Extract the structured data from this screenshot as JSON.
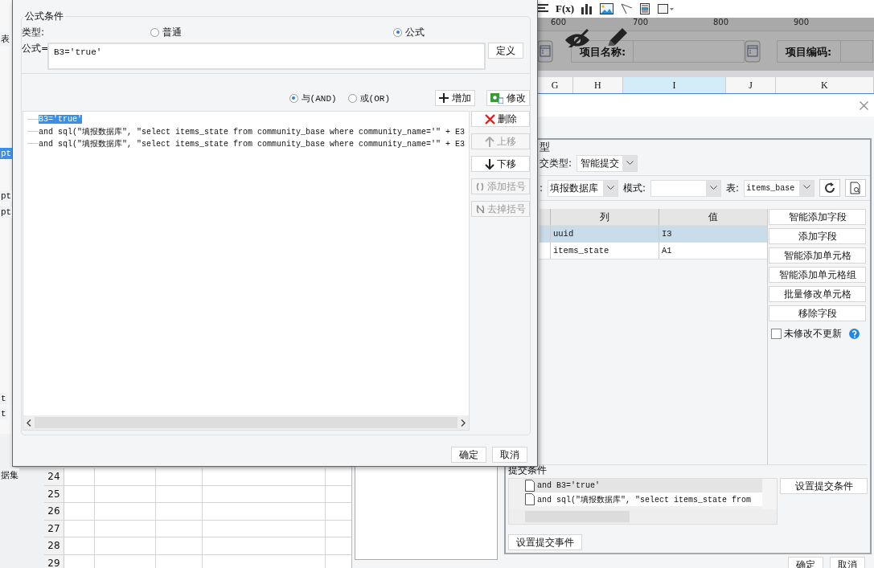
{
  "background": {
    "side_labels": [
      {
        "text": "表",
        "selected": false
      },
      {
        "text": "pt",
        "selected": true
      },
      {
        "text": "pt",
        "selected": false
      },
      {
        "text": "pt",
        "selected": false
      },
      {
        "text": "t",
        "selected": false
      },
      {
        "text": "t",
        "selected": false
      },
      {
        "text": "据集",
        "selected": false
      }
    ],
    "formula_tool": "F(x)",
    "ruler": [
      "600",
      "700",
      "800",
      "900"
    ],
    "parameters": [
      {
        "label": "项目名称:"
      },
      {
        "label": "项目编码:"
      }
    ],
    "columns": [
      {
        "label": "G",
        "selected": false
      },
      {
        "label": "H",
        "selected": false
      },
      {
        "label": "I",
        "selected": true
      },
      {
        "label": "J",
        "selected": false
      },
      {
        "label": "K",
        "selected": false
      }
    ],
    "row_numbers": [
      "24",
      "25",
      "26",
      "27",
      "28",
      "29"
    ]
  },
  "submit_dialog": {
    "section_title": "型",
    "submit_type": {
      "label": "交类型:",
      "value": "智能提交"
    },
    "source": {
      "label": ":",
      "database": "填报数据库",
      "mode_label": "模式:",
      "table_label": "表:",
      "table": "items_base"
    },
    "columns": [
      "列",
      "值"
    ],
    "rows": [
      {
        "column": "uuid",
        "value": "I3",
        "selected": true
      },
      {
        "column": "items_state",
        "value": "A1",
        "selected": false
      }
    ],
    "actions": [
      "智能添加字段",
      "添加字段",
      "智能添加单元格",
      "智能添加单元格组",
      "批量修改单元格",
      "移除字段"
    ],
    "no_update_unmodified": {
      "label": "未修改不更新",
      "checked": false
    },
    "conditions_title": "提交条件",
    "conditions": [
      "and B3='true'",
      "and sql(\"填报数据库\", \"select items_state from"
    ],
    "set_conditions_button": "设置提交条件",
    "set_events_button": "设置提交事件",
    "buttons": [
      "确定",
      "取消"
    ]
  },
  "formula_dialog": {
    "group_title": "公式条件",
    "type_label": "类型:",
    "types": [
      {
        "label": "普通",
        "selected": false
      },
      {
        "label": "公式",
        "selected": true
      }
    ],
    "formula_label": "公式=",
    "formula": "B3='true'",
    "define_button": "定义",
    "joins": [
      {
        "label": "与(AND)",
        "selected": true
      },
      {
        "label": "或(OR)",
        "selected": false
      }
    ],
    "add_button": "增加",
    "edit_button": "修改",
    "conditions": [
      {
        "text": "B3='true'",
        "selected": true
      },
      {
        "text": "and sql(\"填报数据库\", \"select items_state from community_base where community_name='\" + E3",
        "selected": false
      },
      {
        "text": "and sql(\"填报数据库\", \"select items_state from community_base where community_name='\" + E3",
        "selected": false
      }
    ],
    "side_buttons": [
      {
        "kind": "delete",
        "label": "删除",
        "disabled": false
      },
      {
        "kind": "up",
        "label": "上移",
        "disabled": true
      },
      {
        "kind": "down",
        "label": "下移",
        "disabled": false
      },
      {
        "kind": "add_brackets",
        "label": "添加括号",
        "disabled": true
      },
      {
        "kind": "remove_brackets",
        "label": "去掉括号",
        "disabled": true
      }
    ],
    "buttons": [
      "确定",
      "取消"
    ]
  }
}
